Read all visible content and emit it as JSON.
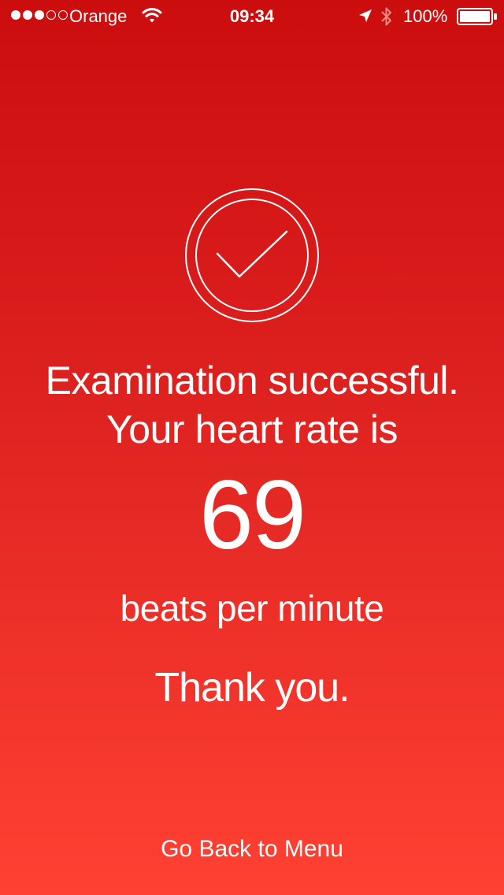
{
  "status_bar": {
    "signal_filled": 3,
    "signal_total": 5,
    "carrier": "Orange",
    "wifi_icon": "wifi-icon",
    "time": "09:34",
    "location_icon": "location-arrow-icon",
    "bluetooth_icon": "bluetooth-icon",
    "battery_percent": "100%",
    "battery_level": 1.0
  },
  "result": {
    "icon": "checkmark-circle-icon",
    "line1": "Examination successful.",
    "line2": "Your heart rate is",
    "heart_rate": "69",
    "unit": "beats per minute",
    "thanks": "Thank you."
  },
  "actions": {
    "back_label": "Go Back to Menu"
  },
  "colors": {
    "gradient_top": "#cc0d0e",
    "gradient_bottom": "#ff4133",
    "foreground": "#ffffff"
  }
}
